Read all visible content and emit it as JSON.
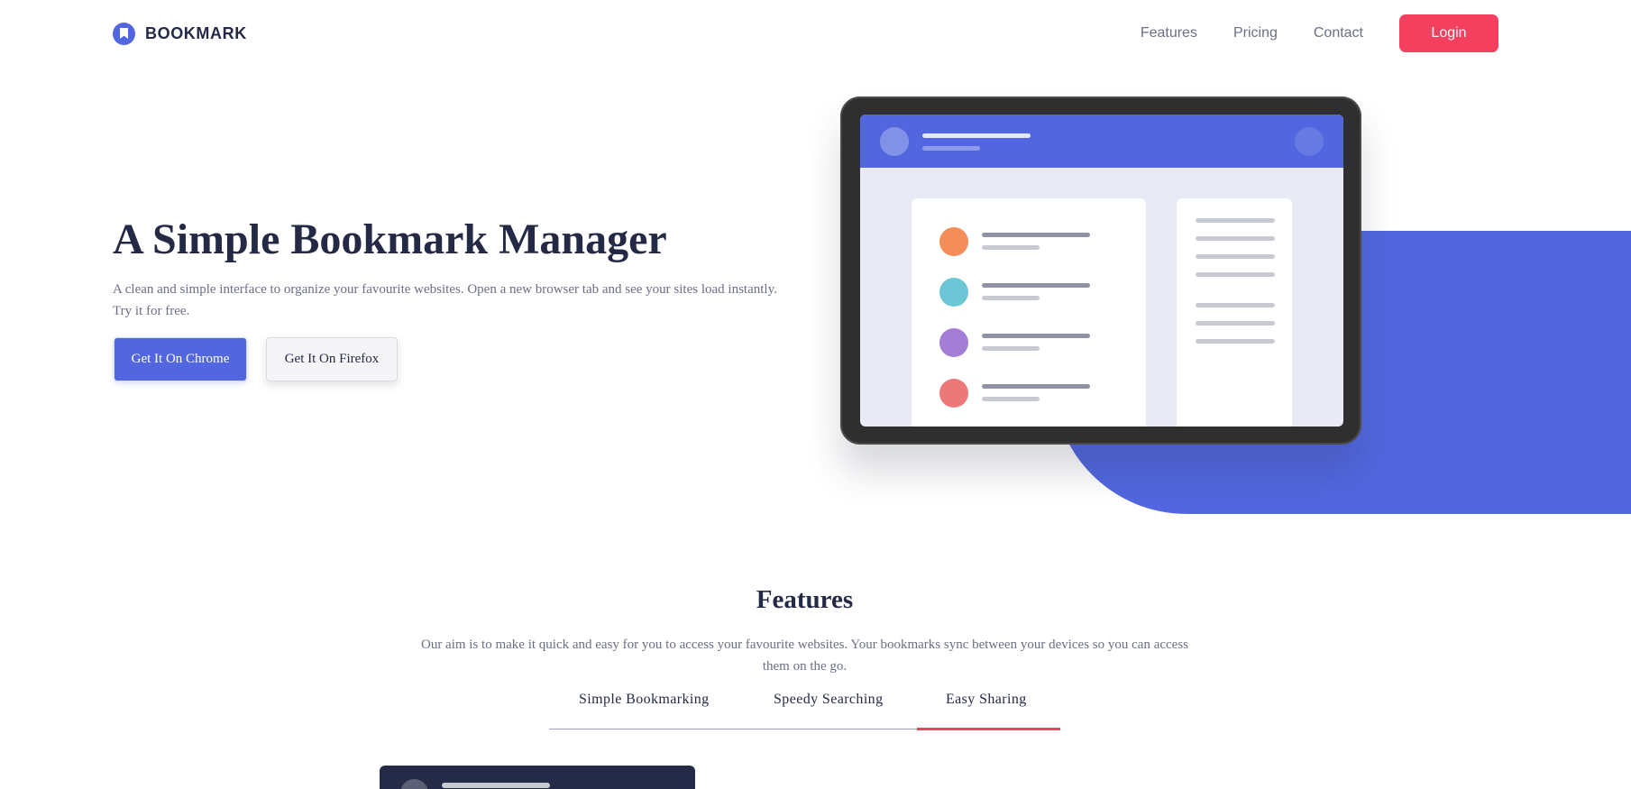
{
  "header": {
    "logo_text": "BOOKMARK",
    "logo_icon": "bookmark-icon",
    "nav": [
      "Features",
      "Pricing",
      "Contact"
    ],
    "login_label": "Login"
  },
  "hero": {
    "title": "A Simple Bookmark Manager",
    "description": "A clean and simple interface to organize your favourite websites. Open a new browser tab and see your sites load instantly. Try it for free.",
    "chrome_button": "Get It On Chrome",
    "firefox_button": "Get It On Firefox"
  },
  "illustration": {
    "dot_colors": [
      "#f58d5a",
      "#6cc6d6",
      "#a47dd6",
      "#ec7878"
    ]
  },
  "features": {
    "title": "Features",
    "description": "Our aim is to make it quick and easy for you to access your favourite websites. Your bookmarks sync between your devices so you can access them on the go.",
    "tabs": [
      "Simple Bookmarking",
      "Speedy Searching",
      "Easy Sharing"
    ],
    "active_tab": "Easy Sharing"
  },
  "colors": {
    "accent_blue": "#5267df",
    "accent_red": "#f43f5f",
    "dark_navy": "#242a45",
    "gray_text": "#6b6f85"
  }
}
